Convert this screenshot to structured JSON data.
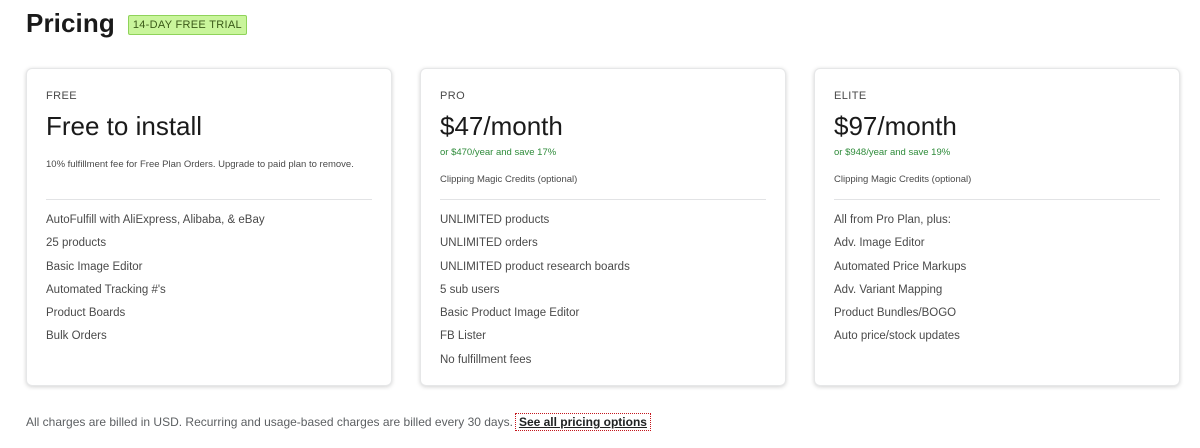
{
  "header": {
    "title": "Pricing",
    "badge": "14-DAY FREE TRIAL"
  },
  "plans": [
    {
      "name": "FREE",
      "price": "Free to install",
      "savings": "",
      "note": "10% fulfillment fee for Free Plan Orders. Upgrade to paid plan to remove.",
      "features": [
        "AutoFulfill with AliExpress, Alibaba, & eBay",
        "25 products",
        "Basic Image Editor",
        "Automated Tracking #'s",
        "Product Boards",
        "Bulk Orders"
      ]
    },
    {
      "name": "PRO",
      "price": "$47/month",
      "savings": "or $470/year and save 17%",
      "note": "Clipping Magic Credits (optional)",
      "features": [
        "UNLIMITED products",
        "UNLIMITED orders",
        "UNLIMITED product research boards",
        "5 sub users",
        "Basic Product Image Editor",
        "FB Lister",
        "No fulfillment fees"
      ]
    },
    {
      "name": "ELITE",
      "price": "$97/month",
      "savings": "or $948/year and save 19%",
      "note": "Clipping Magic Credits (optional)",
      "features": [
        "All from Pro Plan, plus:",
        "Adv. Image Editor",
        "Automated Price Markups",
        "Adv. Variant Mapping",
        "Product Bundles/BOGO",
        "Auto price/stock updates"
      ]
    }
  ],
  "footer": {
    "text": "All charges are billed in USD. Recurring and usage-based charges are billed every 30 days.",
    "link": "See all pricing options"
  },
  "colors": {
    "badge_bg": "#c9f59b",
    "savings_green": "#2e8b3a"
  }
}
